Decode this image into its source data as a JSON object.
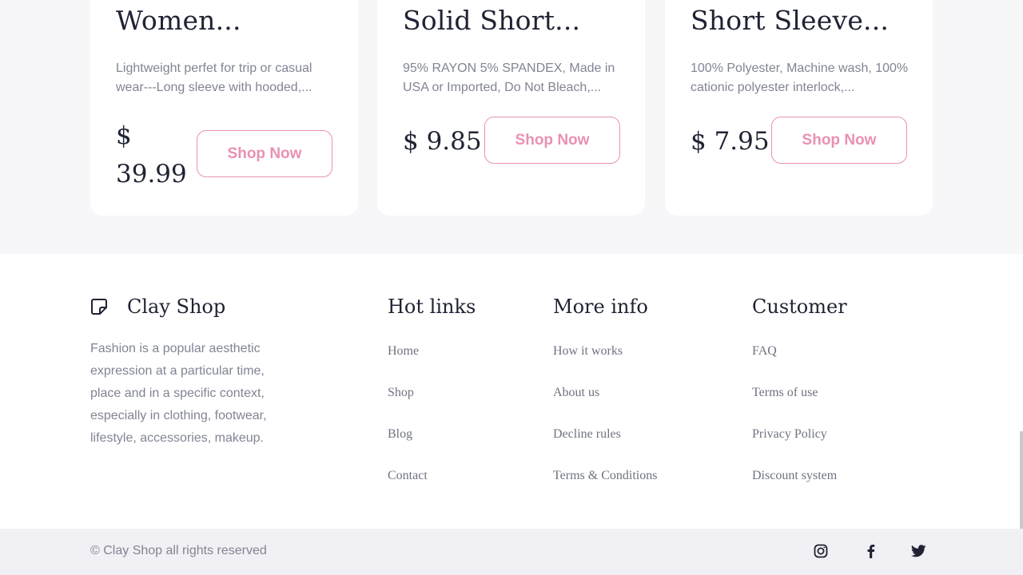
{
  "products": [
    {
      "title": "Women...",
      "description": "Lightweight perfet for trip or casual wear---Long sleeve with hooded,...",
      "price_line1": "$",
      "price_line2": "39.99",
      "button_label": "Shop Now"
    },
    {
      "title": "Solid Short...",
      "description": "95% RAYON 5% SPANDEX, Made in USA or Imported, Do Not Bleach,...",
      "price": "$ 9.85",
      "button_label": "Shop Now"
    },
    {
      "title": "Short Sleeve...",
      "description": "100% Polyester, Machine wash, 100% cationic polyester interlock,...",
      "price": "$ 7.95",
      "button_label": "Shop Now"
    }
  ],
  "footer": {
    "brand": {
      "icon": "sticker-icon",
      "name": "Clay Shop",
      "description": "Fashion is a popular aesthetic expression at a particular time, place and in a specific context, especially in clothing, footwear, lifestyle, accessories, makeup."
    },
    "columns": [
      {
        "title": "Hot links",
        "links": [
          "Home",
          "Shop",
          "Blog",
          "Contact"
        ]
      },
      {
        "title": "More info",
        "links": [
          "How it works",
          "About us",
          "Decline rules",
          "Terms & Conditions"
        ]
      },
      {
        "title": "Customer",
        "links": [
          "FAQ",
          "Terms of use",
          "Privacy Policy",
          "Discount system"
        ]
      }
    ],
    "copyright": "© Clay Shop all rights reserved",
    "social": [
      "instagram-icon",
      "facebook-icon",
      "twitter-icon"
    ]
  },
  "colors": {
    "accent": "#e990b4",
    "heading": "#1f2333",
    "muted": "#818593",
    "page_bg": "#f7f6f9",
    "bottom_bar_bg": "#f1f0f4"
  }
}
